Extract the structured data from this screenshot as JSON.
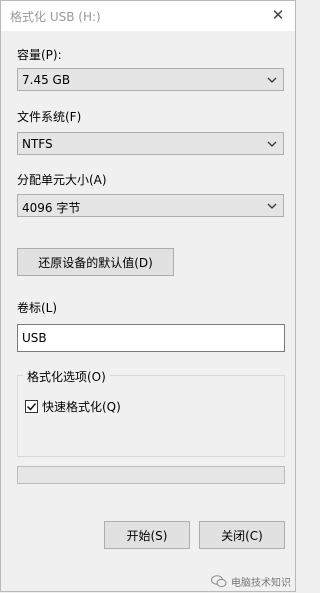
{
  "window": {
    "title": "格式化 USB (H:)"
  },
  "capacity": {
    "label": "容量(P):",
    "value": "7.45 GB"
  },
  "filesystem": {
    "label": "文件系统(F)",
    "value": "NTFS"
  },
  "allocation": {
    "label": "分配单元大小(A)",
    "value": "4096 字节"
  },
  "restore_button": {
    "label": "还原设备的默认值(D)"
  },
  "volume": {
    "label": "卷标(L)",
    "value": "USB"
  },
  "format_options": {
    "legend": "格式化选项(O)",
    "quick_format": {
      "label": "快速格式化(Q)",
      "checked": true
    }
  },
  "progress": {
    "value": 0
  },
  "footer": {
    "start_label": "开始(S)",
    "close_label": "关闭(C)"
  },
  "watermark": {
    "text": "电脑技术知识"
  },
  "icons": {
    "close": "close-icon",
    "dropdown": "chevron-down-icon",
    "check": "checkmark-icon",
    "wechat": "wechat-icon"
  }
}
